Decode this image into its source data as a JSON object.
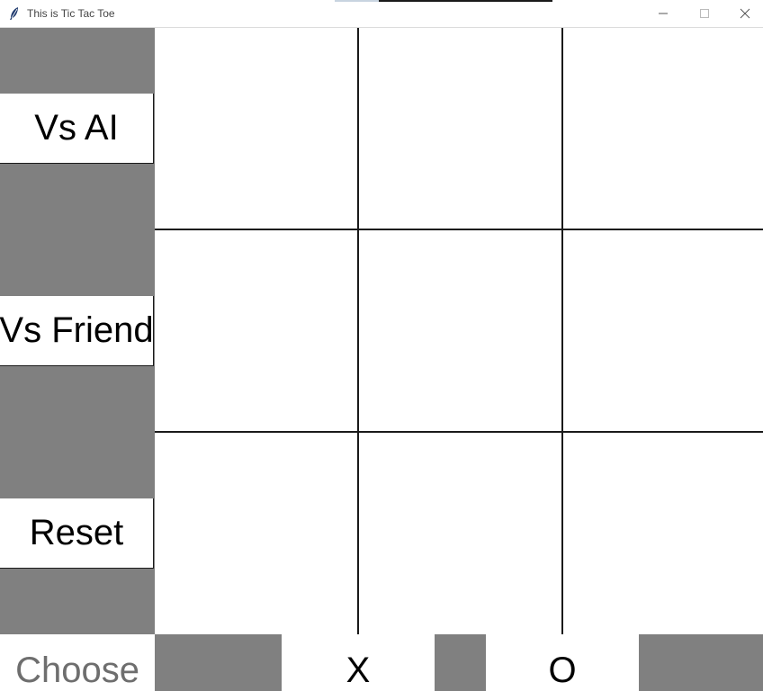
{
  "window": {
    "title": "This is Tic Tac Toe",
    "app_icon": "feather-icon",
    "controls": [
      "minimize-icon",
      "maximize-icon",
      "close-icon"
    ]
  },
  "sidebar": {
    "vs_ai_label": "Vs AI",
    "vs_friend_label": "Vs Friend",
    "reset_label": "Reset"
  },
  "board": {
    "cells": [
      "",
      "",
      "",
      "",
      "",
      "",
      "",
      "",
      ""
    ]
  },
  "bottombar": {
    "choose_label": "Choose",
    "x_label": "X",
    "o_label": "O"
  },
  "colors": {
    "panel_gray": "#808080",
    "grid_line": "#1a1a1a",
    "choose_text": "#6e6e6e"
  }
}
